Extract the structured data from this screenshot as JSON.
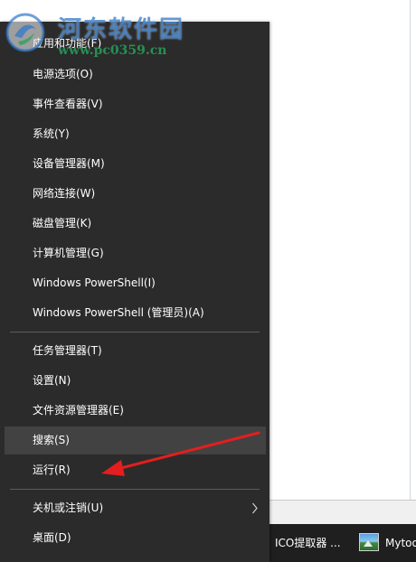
{
  "watermark": {
    "title": "河东软件园",
    "url": "www.pc0359.cn"
  },
  "menu": {
    "groups": [
      [
        {
          "label": "应用和功能(F)",
          "name": "menu-item-apps-and-features"
        },
        {
          "label": "电源选项(O)",
          "name": "menu-item-power-options"
        },
        {
          "label": "事件查看器(V)",
          "name": "menu-item-event-viewer"
        },
        {
          "label": "系统(Y)",
          "name": "menu-item-system"
        },
        {
          "label": "设备管理器(M)",
          "name": "menu-item-device-manager"
        },
        {
          "label": "网络连接(W)",
          "name": "menu-item-network-connections"
        },
        {
          "label": "磁盘管理(K)",
          "name": "menu-item-disk-management"
        },
        {
          "label": "计算机管理(G)",
          "name": "menu-item-computer-management"
        },
        {
          "label": "Windows PowerShell(I)",
          "name": "menu-item-powershell"
        },
        {
          "label": "Windows PowerShell (管理员)(A)",
          "name": "menu-item-powershell-admin"
        }
      ],
      [
        {
          "label": "任务管理器(T)",
          "name": "menu-item-task-manager"
        },
        {
          "label": "设置(N)",
          "name": "menu-item-settings"
        },
        {
          "label": "文件资源管理器(E)",
          "name": "menu-item-file-explorer"
        },
        {
          "label": "搜索(S)",
          "name": "menu-item-search"
        },
        {
          "label": "运行(R)",
          "name": "menu-item-run"
        }
      ],
      [
        {
          "label": "关机或注销(U)",
          "name": "menu-item-shutdown-or-sign-out"
        },
        {
          "label": "桌面(D)",
          "name": "menu-item-desktop"
        }
      ]
    ],
    "hovered_item": "搜索(S)",
    "submenu_arrow_icon": "chevron-right-icon"
  },
  "taskbar": {
    "items": [
      {
        "label": "ICO提取器 ..."
      },
      {
        "label": "Mytoo"
      }
    ]
  },
  "annotation": {
    "color": "#e41e1e",
    "points_to": "运行(R)"
  },
  "colors": {
    "menu_bg": "#2b2b2b",
    "menu_hover": "#424242",
    "taskbar_bg": "#1f1f1f"
  }
}
